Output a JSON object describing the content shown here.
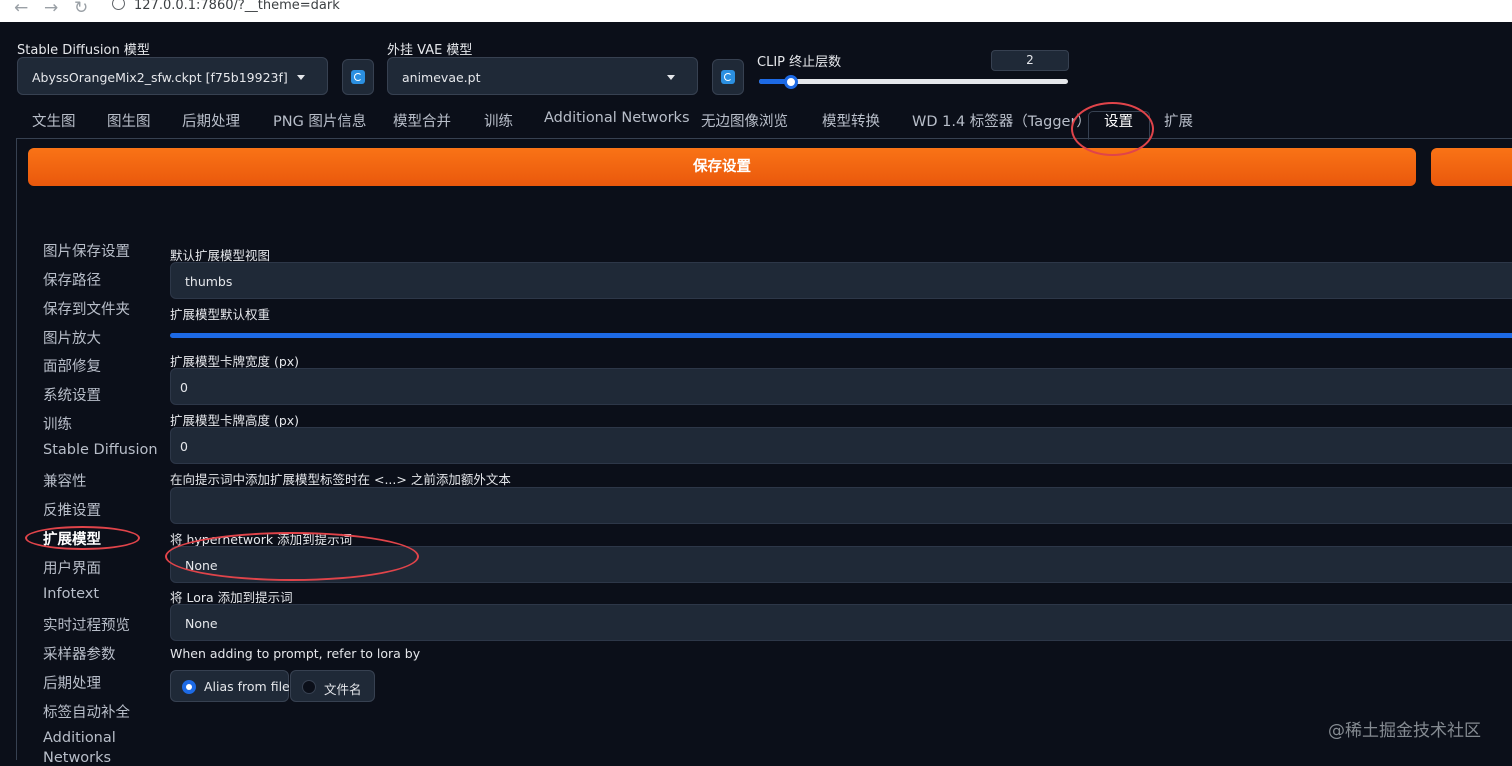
{
  "browser": {
    "url": "127.0.0.1:7860/?__theme=dark"
  },
  "top": {
    "sd_model_label": "Stable Diffusion 模型",
    "sd_model_value": "AbyssOrangeMix2_sfw.ckpt [f75b19923f]",
    "vae_label": "外挂 VAE 模型",
    "vae_value": "animevae.pt",
    "clip_label": "CLIP 终止层数",
    "clip_value": "2"
  },
  "tabs": [
    "文生图",
    "图生图",
    "后期处理",
    "PNG 图片信息",
    "模型合并",
    "训练",
    "Additional Networks",
    "无边图像浏览",
    "模型转换",
    "WD 1.4 标签器（Tagger）",
    "设置",
    "扩展"
  ],
  "save_button": "保存设置",
  "sidebar": [
    "图片保存设置",
    "保存路径",
    "保存到文件夹",
    "图片放大",
    "面部修复",
    "系统设置",
    "训练",
    "Stable Diffusion",
    "兼容性",
    "反推设置",
    "扩展模型",
    "用户界面",
    "Infotext",
    "实时过程预览",
    "采样器参数",
    "后期处理",
    "标签自动补全",
    "Additional",
    "Networks"
  ],
  "settings": {
    "default_view_label": "默认扩展模型视图",
    "default_view_value": "thumbs",
    "default_weight_label": "扩展模型默认权重",
    "card_width_label": "扩展模型卡牌宽度 (px)",
    "card_width_value": "0",
    "card_height_label": "扩展模型卡牌高度 (px)",
    "card_height_value": "0",
    "extra_text_label": "在向提示词中添加扩展模型标签时在 <...> 之前添加额外文本",
    "extra_text_value": "",
    "hypernetwork_label": "将 hypernetwork 添加到提示词",
    "hypernetwork_value": "None",
    "lora_label": "将 Lora 添加到提示词",
    "lora_value": "None",
    "refer_lora_label": "When adding to prompt, refer to lora by",
    "refer_options": [
      "Alias from file",
      "文件名"
    ]
  },
  "watermark": "@稀土掘金技术社区",
  "colors": {
    "accent": "#f97316",
    "background": "#0b0f19",
    "annotation": "#e0444a",
    "slider": "#1d6ae5"
  }
}
